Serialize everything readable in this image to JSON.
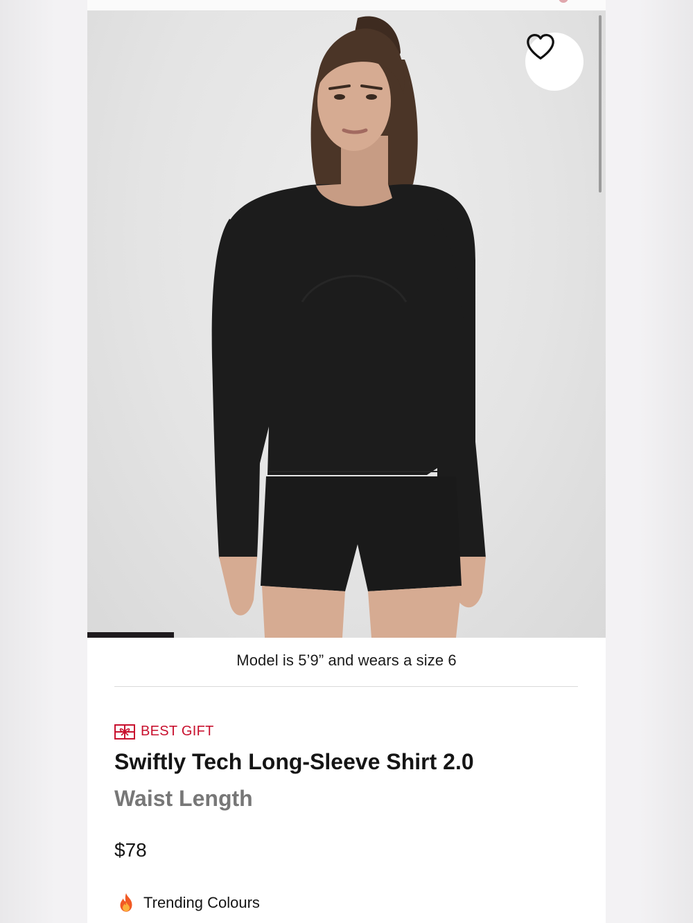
{
  "product": {
    "model_caption": "Model is 5’9” and wears a size 6",
    "badge_label": "BEST GIFT",
    "title": "Swiftly Tech Long-Sleeve Shirt 2.0",
    "subtitle": "Waist Length",
    "price": "$78",
    "trending_label": "Trending Colours"
  },
  "gallery": {
    "progress": 0.167
  },
  "icons": {
    "favorite": "heart-outline-icon",
    "badge": "gift-icon",
    "trending": "fire-emoji"
  },
  "colors": {
    "accent": "#c8102e",
    "garment": "#1c1c1c",
    "hero_background": "#e4e4e4"
  }
}
